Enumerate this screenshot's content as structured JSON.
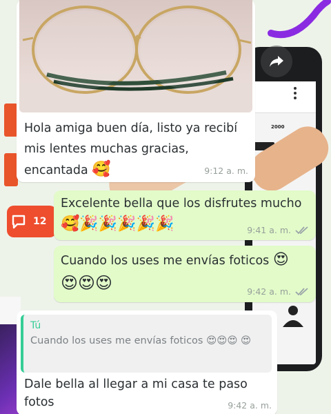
{
  "colors": {
    "incoming_bubble": "#ffffff",
    "outgoing_bubble": "#e2fbc9",
    "quote_accent": "#35cd96",
    "notification_badge": "#ee4d2e",
    "read_ticks": "#9aa3a8"
  },
  "background": {
    "notification_count": "12",
    "phone_stat_value": "2000"
  },
  "forward_icon": "forward-arrow-icon",
  "messages": [
    {
      "direction": "incoming",
      "has_photo": true,
      "photo_subject": "glasses",
      "text": "Hola amiga buen día, listo ya recibí mis lentes muchas gracias, encantada",
      "emojis": "🥰",
      "time": "9:12 a. m."
    },
    {
      "direction": "outgoing",
      "text": "Excelente bella que los disfrutes mucho",
      "emojis": "🥰🎉🎉🎉🎉🎉",
      "time": "9:41 a. m.",
      "status_icon": "double-check-icon"
    },
    {
      "direction": "outgoing",
      "text": "Cuando los uses me envías foticos",
      "emojis_inline": "😍",
      "emojis": "😍😍😍",
      "time": "9:42 a. m.",
      "status_icon": "double-check-icon"
    },
    {
      "direction": "incoming",
      "reply": {
        "author": "Tú",
        "text": "Cuando los uses me envías foticos 😍😍😍 😍"
      },
      "text": "Dale bella al llegar a mi casa te paso fotos",
      "time": "9:42 a. m."
    }
  ]
}
